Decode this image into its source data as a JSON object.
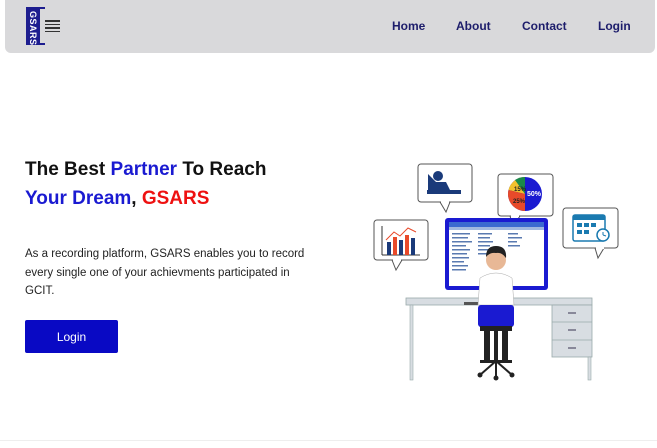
{
  "logo": {
    "text": "GSARS"
  },
  "nav": {
    "home": "Home",
    "about": "About",
    "contact": "Contact",
    "login": "Login"
  },
  "hero": {
    "title_part1": "The Best ",
    "title_partner": "Partner",
    "title_part2": " To Reach",
    "title_dream": "Your Dream",
    "title_comma": ", ",
    "title_brand": "GSARS",
    "description": "As a recording platform, GSARS enables you to record every single one of your achievments participated in GCIT.",
    "button_label": "Login"
  },
  "illustration": {
    "pie_labels": [
      "15%",
      "50%",
      "25%"
    ]
  },
  "colors": {
    "accent_blue": "#0909c4",
    "brand_red": "#ee1111",
    "navbar_bg": "#d9d9db"
  }
}
